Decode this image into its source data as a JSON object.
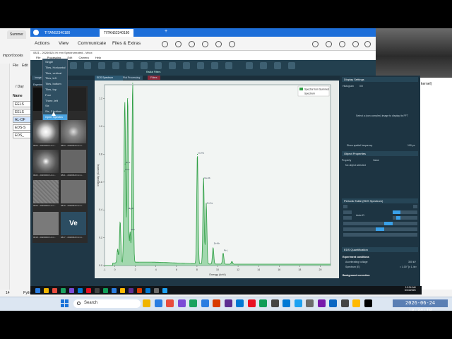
{
  "background_browser": {
    "tabs": [
      "Summer"
    ],
    "menu": [
      "File",
      "Edit"
    ],
    "import_label": "import books",
    "files": [
      "EELS",
      "EELS",
      "AL-OF",
      "EDS-S",
      "EDS_"
    ],
    "path_label": "/ Day",
    "name_header": "Name",
    "status_left": "14",
    "python_label": "Pyth",
    "right_text": "kernel)"
  },
  "remote": {
    "tabs": [
      "TITAN52340180",
      "TITAN52340180"
    ],
    "menus": [
      "Actions",
      "View",
      "Communicate",
      "Files & Extras"
    ]
  },
  "app": {
    "title": "0821 - 20260624 Hi mm Spectrumrated - Velox",
    "menubar": [
      "File",
      "Processing",
      "Edit",
      "Camera",
      "Help"
    ],
    "tabs": [
      "Image",
      "Processing",
      "Plot Processing",
      "Filters"
    ],
    "toolbar_labels": [
      "Radial Filters"
    ],
    "dropdown": {
      "items": [
        "Single",
        "Tiles, Horizontal",
        "Tiles, vertical",
        "Tiles, left",
        "Tiles, bottom",
        "Tiles, top",
        "Four",
        "Three, left",
        "Six",
        "Six, 2 bottom",
        "Open Spectra",
        "Open Spectra"
      ],
      "selected_index": 10
    },
    "thumbnails": {
      "header": "Experiments",
      "captions": [
        "0824 - 20260623 Hi m...",
        "0823 - 20260623 Hi m...",
        "0822 - 20260623 Hi m...",
        "0821 - 20260623 Hi m...",
        "0820 - 20260623 Hi m...",
        "0819 - 20260623 Hi m...",
        "0818 - 20260623 Hi m...",
        "0817 - 20260623 Hi m..."
      ],
      "ve_label": "Ve"
    },
    "plot_tab": "EDS Spectrum",
    "right_panel": {
      "display_settings": "Display Settings",
      "histogram": "Histogram",
      "histogram_val": "0/0",
      "select_msg": "Select a (non complex) image to display its FFT",
      "show_spatial": "Show spatial frequency",
      "spatial_val": "100 px",
      "object_properties": "Object Properties",
      "property_col": "Property",
      "value_col": "Value",
      "no_object": "No object selected",
      "periodic_table": "Periodic Table (EDS Spectrum)",
      "auto_id": "Auto-ID",
      "eds_quant": "EDS Quantification",
      "experiment_conditions": "Experiment conditions",
      "accel_label": "Accelerating voltage",
      "accel_val": "300 kV",
      "spectrum_label": "Spectrum (E)",
      "spectrum_val": "≈ 1.00° [x 1.4e²",
      "background_correction": "Background correction"
    }
  },
  "chart_data": {
    "type": "line",
    "title": "",
    "xlabel": "Energy (keV)",
    "ylabel": "Intensity (Counts)",
    "xlim": [
      -1,
      21
    ],
    "ylim": [
      0,
      1.3
    ],
    "xticks": [
      -1,
      0,
      2,
      4,
      6,
      8,
      10,
      12,
      14,
      16,
      18,
      20
    ],
    "yticks": [
      0,
      0.2,
      0.4,
      0.6,
      0.8,
      1.0,
      1.2
    ],
    "legend": {
      "placement": "top-right",
      "title": "Spectra from Summed",
      "entries": [
        "Spectrum"
      ]
    },
    "series": [
      {
        "name": "Spectrum",
        "color": "#2f9e44",
        "peaks": [
          {
            "x": 0.28,
            "y": 0.1
          },
          {
            "x": 0.52,
            "y": 0.3
          },
          {
            "x": 0.93,
            "y": 0.68
          },
          {
            "x": 1.01,
            "y": 0.73
          },
          {
            "x": 1.25,
            "y": 1.2
          },
          {
            "x": 1.49,
            "y": 0.22
          },
          {
            "x": 1.74,
            "y": 1.31
          },
          {
            "x": 8.04,
            "y": 0.8
          },
          {
            "x": 8.64,
            "y": 0.62
          },
          {
            "x": 8.9,
            "y": 0.44
          },
          {
            "x": 9.57,
            "y": 0.12
          },
          {
            "x": 10.55,
            "y": 0.08
          },
          {
            "x": 11.4,
            "y": 0.02
          }
        ]
      }
    ],
    "annotations": [
      "Cu-Ka",
      "Cu-Kb",
      "Zn-Ka",
      "Zn-Kb",
      "Zn-L",
      "Cu-L",
      "Mg-K",
      "Al-K",
      "Pt-L"
    ]
  },
  "taskbar": {
    "search_placeholder": "Search",
    "clock": "2026-06-24 10:34:10",
    "remote_clock_time": "10:34 AM",
    "remote_clock_date": "6/24/2026",
    "app_colors": [
      "#f0b400",
      "#2a7de1",
      "#e84c3d",
      "#7b4bd6",
      "#1aa260",
      "#2a7de1",
      "#d83b01",
      "#5c2d91",
      "#0078d4",
      "#e81123",
      "#0f9d58",
      "#444444",
      "#0078d4",
      "#1da1f2",
      "#6b6b6b",
      "#7719aa",
      "#0a66c2",
      "#444444",
      "#ffb900",
      "#000000"
    ]
  }
}
